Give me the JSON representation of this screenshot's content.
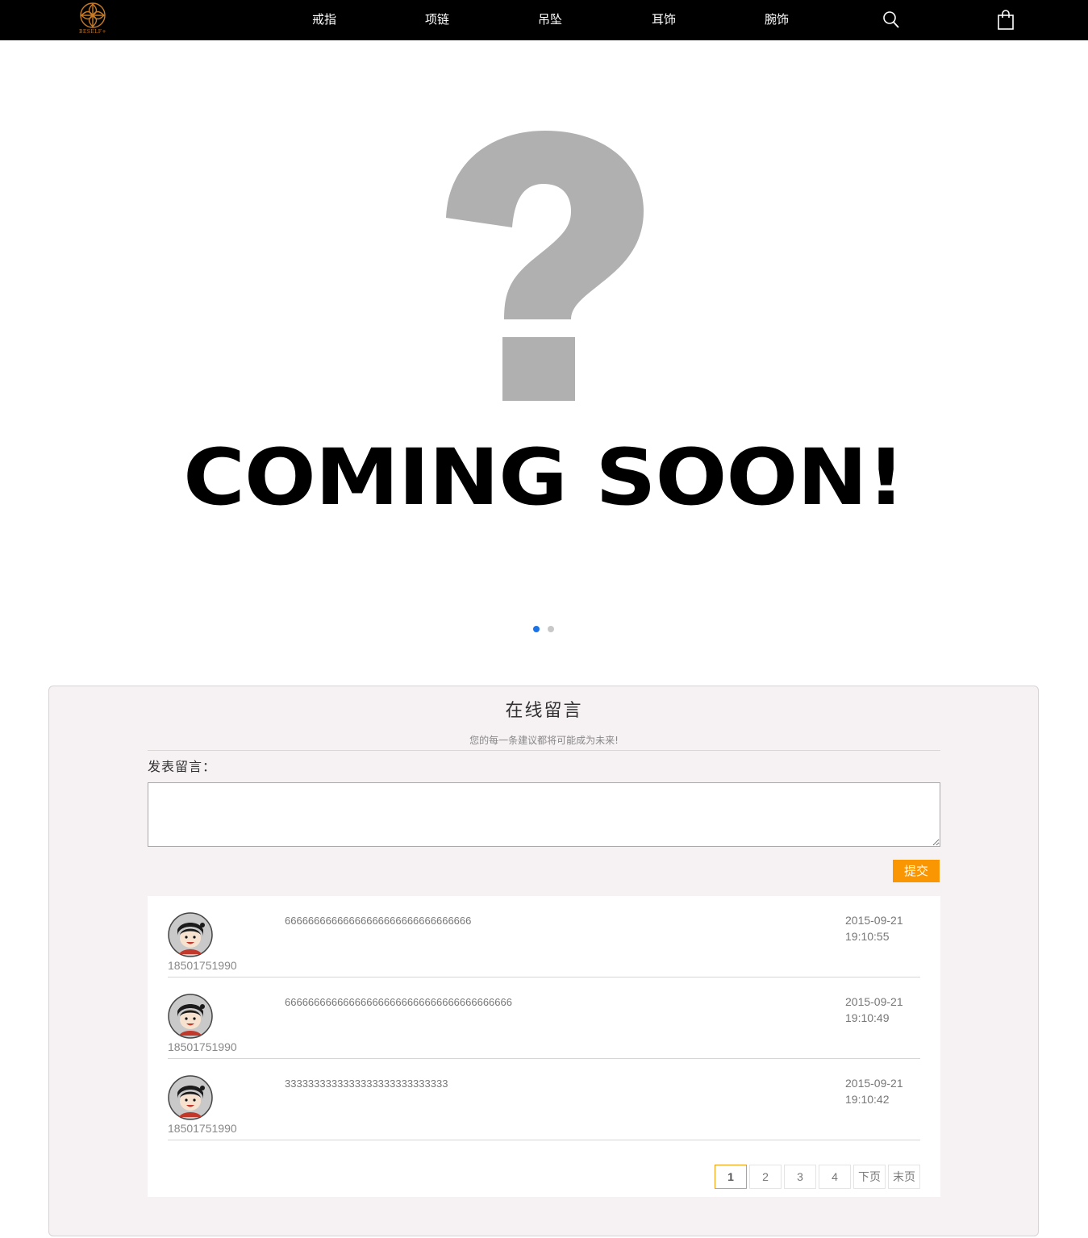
{
  "brand": {
    "logo_text": "BESELF+",
    "accent": "#c87a25"
  },
  "nav": {
    "items": [
      "戒指",
      "项链",
      "吊坠",
      "耳饰",
      "腕饰"
    ],
    "search_icon": "search-icon",
    "cart_icon": "shopping-bag-icon"
  },
  "hero": {
    "headline": "COMING SOON!",
    "slide_count": 2,
    "active_slide": 1,
    "dot_active_color": "#1a73e8",
    "dot_inactive_color": "#c8c8c8",
    "mark_color": "#b0b0b0"
  },
  "board": {
    "title": "在线留言",
    "subtitle": "您的每一条建议都将可能成为未来!",
    "post_label": "发表留言：",
    "input_value": "",
    "submit_label": "提交",
    "submit_color": "#fa9602",
    "messages": [
      {
        "user": "18501751990",
        "content": "66666666666666666666666666666666",
        "date": "2015-09-21",
        "time": "19:10:55"
      },
      {
        "user": "18501751990",
        "content": "666666666666666666666666666666666666666",
        "date": "2015-09-21",
        "time": "19:10:49"
      },
      {
        "user": "18501751990",
        "content": "3333333333333333333333333333",
        "date": "2015-09-21",
        "time": "19:10:42"
      }
    ]
  },
  "pagination": {
    "pages": [
      "1",
      "2",
      "3",
      "4"
    ],
    "current": "1",
    "next_label": "下页",
    "last_label": "末页",
    "active_color": "#f19a16"
  }
}
